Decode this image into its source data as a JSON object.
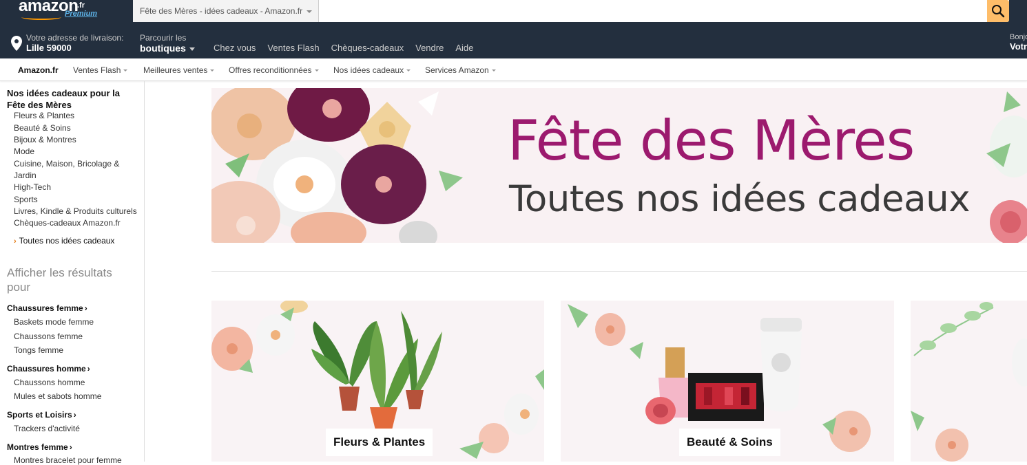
{
  "header": {
    "logo_text": "amazon",
    "logo_tld": ".fr",
    "logo_sub": "Premium",
    "search_department": "Fête des Mères - idées cadeaux - Amazon.fr",
    "search_value": "",
    "search_placeholder": ""
  },
  "navbar": {
    "delivery_line1": "Votre adresse de livraison:",
    "delivery_line2": "Lille 59000",
    "shop_line1": "Parcourir les",
    "shop_line2": "boutiques",
    "links": [
      "Chez vous",
      "Ventes Flash",
      "Chèques-cadeaux",
      "Vendre",
      "Aide"
    ],
    "account_line1": "Bonjour",
    "account_line2": "Votre"
  },
  "subnav": {
    "home": "Amazon.fr",
    "items": [
      "Ventes Flash",
      "Meilleures ventes",
      "Offres reconditionnées",
      "Nos idées cadeaux",
      "Services Amazon"
    ]
  },
  "sidebar": {
    "heading": "Nos idées cadeaux pour la Fête des Mères",
    "categories": [
      "Fleurs & Plantes",
      "Beauté & Soins",
      "Bijoux & Montres",
      "Mode",
      "Cuisine, Maison, Bricolage & Jardin",
      "High-Tech",
      "Sports",
      "Livres, Kindle & Produits culturels",
      "Chèques-cadeaux Amazon.fr"
    ],
    "all_gifts": "Toutes nos idées cadeaux",
    "results_heading": "Afficher les résultats pour",
    "groups": [
      {
        "title": "Chaussures femme",
        "items": [
          "Baskets mode femme",
          "Chaussons femme",
          "Tongs femme"
        ]
      },
      {
        "title": "Chaussures homme",
        "items": [
          "Chaussons homme",
          "Mules et sabots homme"
        ]
      },
      {
        "title": "Sports et Loisirs",
        "items": [
          "Trackers d'activité"
        ]
      },
      {
        "title": "Montres femme",
        "items": [
          "Montres bracelet pour femme"
        ]
      }
    ]
  },
  "hero": {
    "title": "Fête des Mères",
    "subtitle": "Toutes nos idées cadeaux",
    "title_color": "#9c1a6e"
  },
  "cards": [
    {
      "label": "Fleurs & Plantes"
    },
    {
      "label": "Beauté & Soins"
    },
    {
      "label": ""
    }
  ],
  "colors": {
    "header_bg": "#232f3e",
    "search_button": "#febd69",
    "accent_orange": "#e47911"
  },
  "icons": {
    "search": "search-icon",
    "location": "location-pin-icon",
    "chevron": "chevron-right-icon"
  }
}
